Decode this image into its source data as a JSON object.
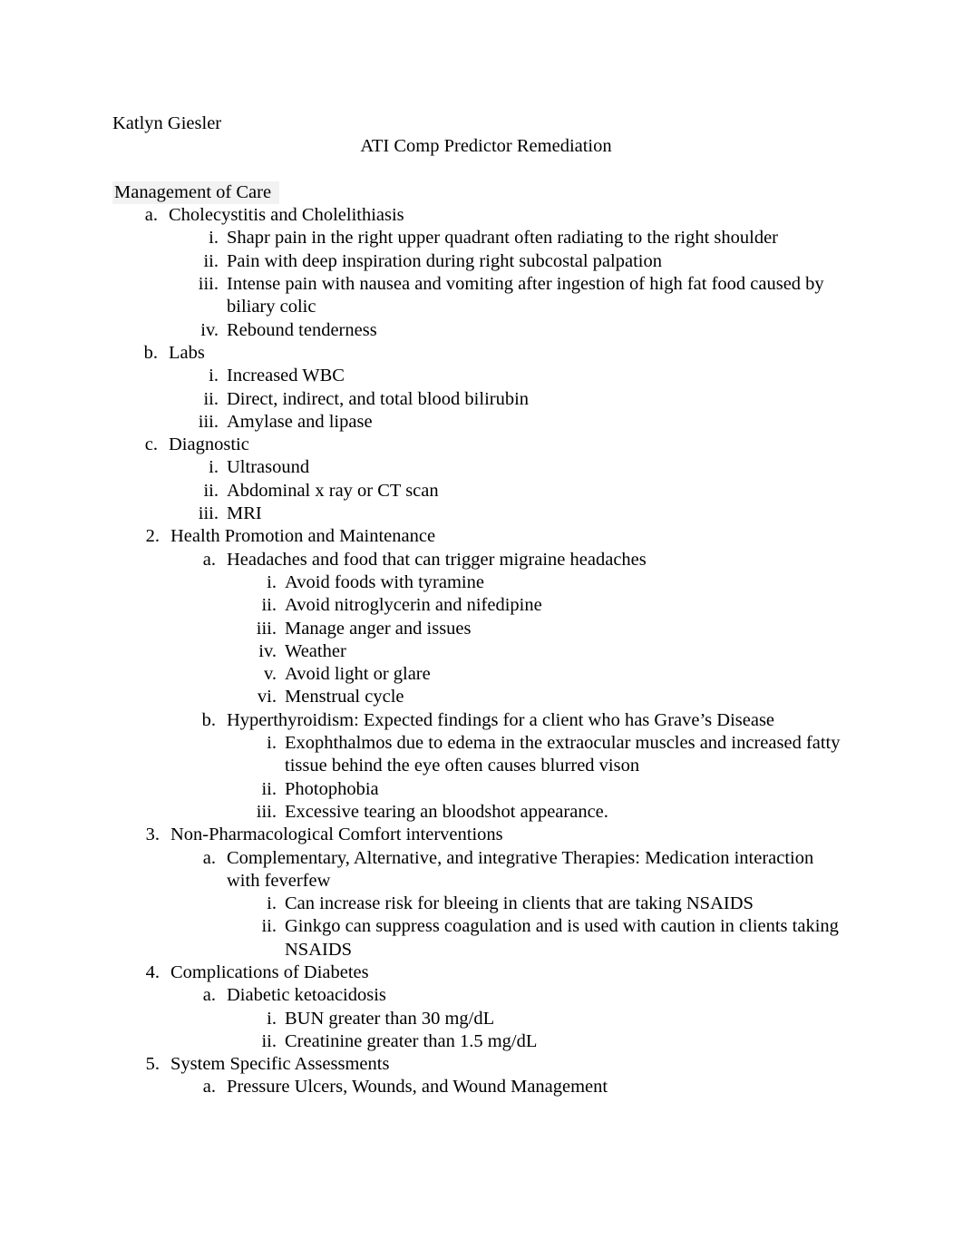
{
  "document": {
    "author": "Katlyn Giesler",
    "title": "ATI Comp Predictor Remediation",
    "section_heading": "Management of Care"
  },
  "outline": {
    "first_section_children": [
      {
        "marker": "a.",
        "text": "Cholecystitis and Cholelithiasis",
        "children": [
          {
            "marker": "i.",
            "text": "Shapr pain in the right upper quadrant often radiating to the right shoulder"
          },
          {
            "marker": "ii.",
            "text": "Pain with deep inspiration during right subcostal palpation"
          },
          {
            "marker": "iii.",
            "text": "Intense pain with nausea and vomiting after ingestion of high fat food caused by biliary colic"
          },
          {
            "marker": "iv.",
            "text": "Rebound tenderness"
          }
        ]
      },
      {
        "marker": "b.",
        "text": "Labs",
        "children": [
          {
            "marker": "i.",
            "text": "Increased WBC"
          },
          {
            "marker": "ii.",
            "text": "Direct, indirect, and total blood bilirubin"
          },
          {
            "marker": "iii.",
            "text": "Amylase and lipase"
          }
        ]
      },
      {
        "marker": "c.",
        "text": "Diagnostic",
        "children": [
          {
            "marker": "i.",
            "text": "Ultrasound"
          },
          {
            "marker": "ii.",
            "text": "Abdominal x ray or CT scan"
          },
          {
            "marker": "iii.",
            "text": "MRI"
          }
        ]
      }
    ],
    "sections": [
      {
        "marker": "2.",
        "text": "Health Promotion and Maintenance",
        "children": [
          {
            "marker": "a.",
            "text": "Headaches and food that can trigger migraine headaches",
            "children": [
              {
                "marker": "i.",
                "text": "Avoid foods with tyramine"
              },
              {
                "marker": "ii.",
                "text": "Avoid nitroglycerin and nifedipine"
              },
              {
                "marker": "iii.",
                "text": "Manage anger and issues"
              },
              {
                "marker": "iv.",
                "text": "Weather"
              },
              {
                "marker": "v.",
                "text": "Avoid light or glare"
              },
              {
                "marker": "vi.",
                "text": "Menstrual cycle"
              }
            ]
          },
          {
            "marker": "b.",
            "text": "Hyperthyroidism: Expected findings for a client who has Grave’s Disease",
            "children": [
              {
                "marker": "i.",
                "text": "Exophthalmos due to edema in the extraocular muscles and increased fatty tissue behind the eye often causes blurred vison"
              },
              {
                "marker": "ii.",
                "text": "Photophobia"
              },
              {
                "marker": "iii.",
                "text": "Excessive tearing an bloodshot appearance."
              }
            ]
          }
        ]
      },
      {
        "marker": "3.",
        "text": "Non-Pharmacological Comfort interventions",
        "children": [
          {
            "marker": "a.",
            "text": "Complementary, Alternative, and integrative Therapies: Medication interaction with feverfew",
            "children": [
              {
                "marker": "i.",
                "text": "Can increase risk for bleeing in clients that are taking NSAIDS"
              },
              {
                "marker": "ii.",
                "text": "Ginkgo can suppress coagulation and is used with caution in clients taking NSAIDS"
              }
            ]
          }
        ]
      },
      {
        "marker": "4.",
        "text": "Complications of Diabetes",
        "children": [
          {
            "marker": "a.",
            "text": "Diabetic ketoacidosis",
            "children": [
              {
                "marker": "i.",
                "text": "BUN greater than 30 mg/dL"
              },
              {
                "marker": "ii.",
                "text": "Creatinine greater than 1.5 mg/dL"
              }
            ]
          }
        ]
      },
      {
        "marker": "5.",
        "text": "System Specific Assessments",
        "children": [
          {
            "marker": "a.",
            "text": "Pressure Ulcers, Wounds, and Wound Management",
            "children": []
          }
        ]
      }
    ]
  },
  "colors": {
    "page_background": "#ffffff",
    "text": "#000000",
    "heading_shade": "#f2f2f2"
  }
}
